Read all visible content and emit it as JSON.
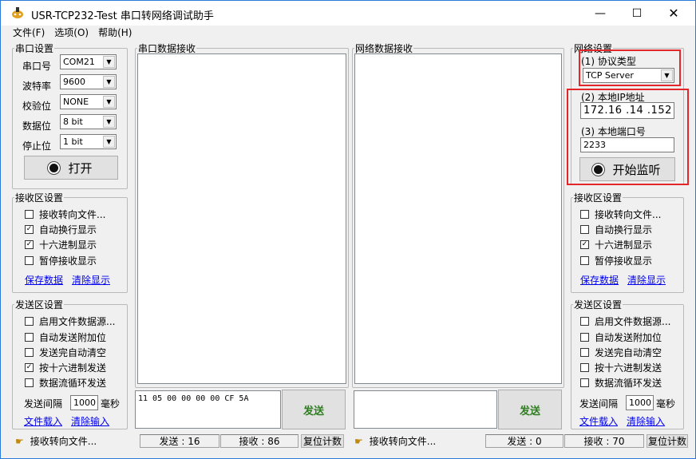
{
  "window": {
    "title": "USR-TCP232-Test 串口转网络调试助手",
    "minimize_icon": "minimize-icon",
    "maximize_icon": "maximize-icon",
    "close_icon": "close-icon"
  },
  "menu": [
    "文件(F)",
    "选项(O)",
    "帮助(H)"
  ],
  "serial_settings": {
    "legend": "串口设置",
    "rows": [
      {
        "label": "串口号",
        "value": "COM21"
      },
      {
        "label": "波特率",
        "value": "9600"
      },
      {
        "label": "校验位",
        "value": "NONE"
      },
      {
        "label": "数据位",
        "value": "8 bit"
      },
      {
        "label": "停止位",
        "value": "1 bit"
      }
    ],
    "open_button": "打开"
  },
  "left_receive": {
    "legend": "接收区设置",
    "options": [
      {
        "label": "接收转向文件...",
        "checked": false
      },
      {
        "label": "自动换行显示",
        "checked": true
      },
      {
        "label": "十六进制显示",
        "checked": true
      },
      {
        "label": "暂停接收显示",
        "checked": false
      }
    ],
    "save_link": "保存数据",
    "clear_link": "清除显示"
  },
  "left_send": {
    "legend": "发送区设置",
    "options": [
      {
        "label": "启用文件数据源...",
        "checked": false
      },
      {
        "label": "自动发送附加位",
        "checked": false
      },
      {
        "label": "发送完自动清空",
        "checked": false
      },
      {
        "label": "按十六进制发送",
        "checked": true
      },
      {
        "label": "数据流循环发送",
        "checked": false
      }
    ],
    "interval_label": "发送间隔",
    "interval_value": "1000",
    "interval_unit": "毫秒",
    "load_link": "文件载入",
    "clear_link": "清除输入"
  },
  "serial_receive": {
    "legend": "串口数据接收"
  },
  "net_receive": {
    "legend": "网络数据接收"
  },
  "serial_send": {
    "text": "11 05 00 00 00 00 CF 5A",
    "button": "发送"
  },
  "net_send": {
    "text": "",
    "button": "发送"
  },
  "network_settings": {
    "legend": "网络设置",
    "protocol_label": "(1) 协议类型",
    "protocol_value": "TCP Server",
    "ip_label": "(2) 本地IP地址",
    "ip_value": "172.16 .14 .152",
    "port_label": "(3) 本地端口号",
    "port_value": "2233",
    "listen_button": "开始监听"
  },
  "right_receive": {
    "legend": "接收区设置",
    "options": [
      {
        "label": "接收转向文件...",
        "checked": false
      },
      {
        "label": "自动换行显示",
        "checked": false
      },
      {
        "label": "十六进制显示",
        "checked": true
      },
      {
        "label": "暂停接收显示",
        "checked": false
      }
    ],
    "save_link": "保存数据",
    "clear_link": "清除显示"
  },
  "right_send": {
    "legend": "发送区设置",
    "options": [
      {
        "label": "启用文件数据源...",
        "checked": false
      },
      {
        "label": "自动发送附加位",
        "checked": false
      },
      {
        "label": "发送完自动清空",
        "checked": false
      },
      {
        "label": "按十六进制发送",
        "checked": false
      },
      {
        "label": "数据流循环发送",
        "checked": false
      }
    ],
    "interval_label": "发送间隔",
    "interval_value": "1000",
    "interval_unit": "毫秒",
    "load_link": "文件载入",
    "clear_link": "清除输入"
  },
  "status": {
    "left_redirect": "接收转向文件...",
    "left_sent": "发送 : 16",
    "left_recv": "接收 : 86",
    "left_reset": "复位计数",
    "right_redirect": "接收转向文件...",
    "right_sent": "发送 : 0",
    "right_recv": "接收 : 70",
    "right_reset": "复位计数"
  },
  "colors": {
    "highlight": "#e3262a",
    "link": "#0000ee",
    "send_button": "#e1e1e1"
  }
}
